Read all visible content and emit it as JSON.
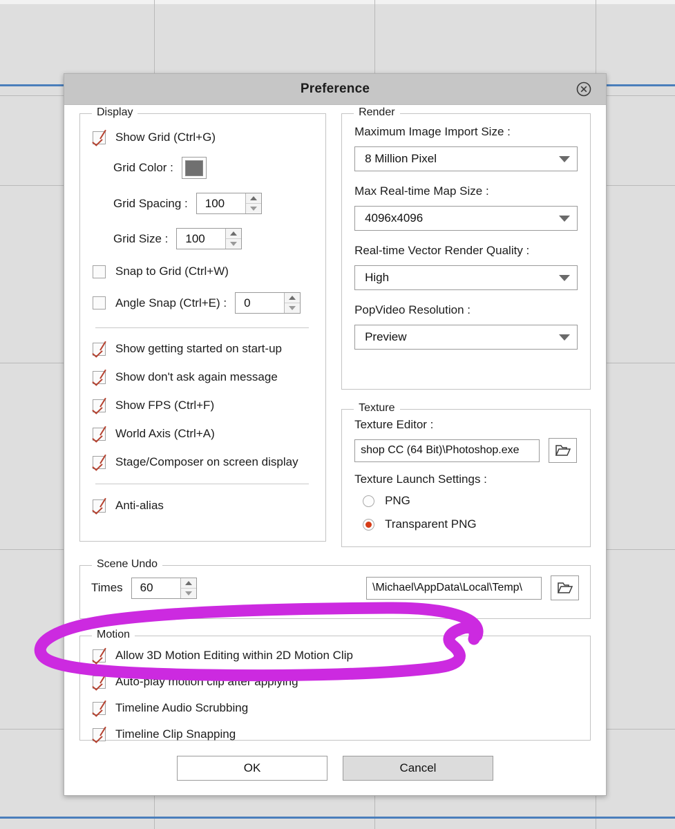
{
  "dialog": {
    "title": "Preference",
    "close_icon": "close-circle-icon"
  },
  "display": {
    "legend": "Display",
    "show_grid": {
      "label": "Show Grid (Ctrl+G)",
      "checked": true
    },
    "grid_color": {
      "label": "Grid Color :",
      "value": "#707070"
    },
    "grid_spacing": {
      "label": "Grid Spacing :",
      "value": "100"
    },
    "grid_size": {
      "label": "Grid Size :",
      "value": "100"
    },
    "snap_to_grid": {
      "label": "Snap to Grid (Ctrl+W)",
      "checked": false
    },
    "angle_snap": {
      "label": "Angle Snap (Ctrl+E) :",
      "checked": false,
      "value": "0"
    },
    "show_getting_started": {
      "label": "Show getting started on start-up",
      "checked": true
    },
    "show_dont_ask": {
      "label": "Show don't ask again message",
      "checked": true
    },
    "show_fps": {
      "label": "Show FPS (Ctrl+F)",
      "checked": true
    },
    "world_axis": {
      "label": "World Axis (Ctrl+A)",
      "checked": true
    },
    "stage_composer": {
      "label": "Stage/Composer on screen display",
      "checked": true
    },
    "anti_alias": {
      "label": "Anti-alias",
      "checked": true
    }
  },
  "render": {
    "legend": "Render",
    "max_image_import_size": {
      "label": "Maximum Image Import Size :",
      "value": "8 Million Pixel"
    },
    "max_realtime_map_size": {
      "label": "Max Real-time Map Size :",
      "value": "4096x4096"
    },
    "realtime_vector_quality": {
      "label": "Real-time Vector Render Quality :",
      "value": "High"
    },
    "popvideo_resolution": {
      "label": "PopVideo Resolution :",
      "value": "Preview"
    }
  },
  "texture": {
    "legend": "Texture",
    "editor_label": "Texture Editor :",
    "editor_path": "shop CC (64 Bit)\\Photoshop.exe",
    "browse_icon": "folder-open-icon",
    "launch_settings_label": "Texture Launch Settings :",
    "png": {
      "label": "PNG",
      "selected": false
    },
    "transparent_png": {
      "label": "Transparent PNG",
      "selected": true
    }
  },
  "scene_undo": {
    "legend": "Scene Undo",
    "times_label": "Times",
    "times_value": "60",
    "temp_path": "\\Michael\\AppData\\Local\\Temp\\",
    "browse_icon": "folder-open-icon"
  },
  "motion": {
    "legend": "Motion",
    "items": [
      {
        "label": "Allow 3D Motion Editing within 2D Motion Clip",
        "checked": true
      },
      {
        "label": "Auto-play motion clip after applying",
        "checked": true
      },
      {
        "label": "Timeline Audio Scrubbing",
        "checked": true
      },
      {
        "label": "Timeline Clip Snapping",
        "checked": true
      }
    ]
  },
  "buttons": {
    "ok": "OK",
    "cancel": "Cancel"
  },
  "annotation": {
    "color": "#cc2ae0",
    "shape": "hand-drawn-ellipse-highlight"
  },
  "background": {
    "grid_line_color": "#b9b9b9",
    "guide_color": "#4a7ebb",
    "canvas_color": "#dedede"
  }
}
